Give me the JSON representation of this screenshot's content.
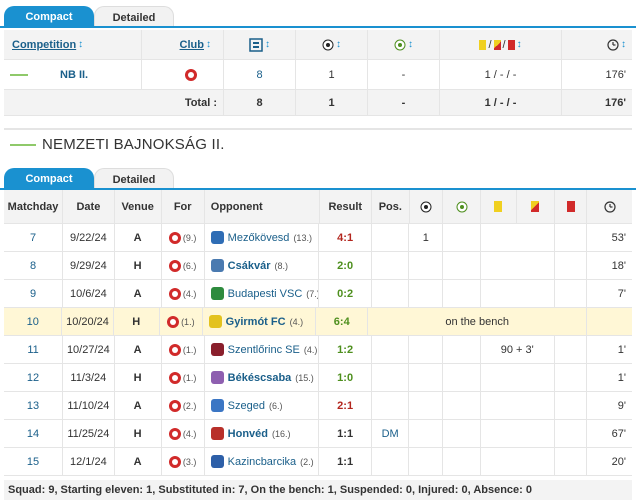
{
  "tabs_top": {
    "compact": "Compact",
    "detailed": "Detailed"
  },
  "summary": {
    "headers": {
      "competition": "Competition",
      "club": "Club"
    },
    "row": {
      "competition": "NB II.",
      "apps": "8",
      "goals": "1",
      "assists": "-",
      "cards": "1 / - / -",
      "minutes": "176'"
    },
    "total": {
      "label": "Total :",
      "apps": "8",
      "goals": "1",
      "assists": "-",
      "cards": "1 / - / -",
      "minutes": "176'"
    }
  },
  "section": {
    "title": "NEMZETI BAJNOKSÁG II."
  },
  "tabs_bottom": {
    "compact": "Compact",
    "detailed": "Detailed"
  },
  "matches_header": {
    "matchday": "Matchday",
    "date": "Date",
    "venue": "Venue",
    "for": "For",
    "opponent": "Opponent",
    "result": "Result",
    "pos": "Pos."
  },
  "matches": [
    {
      "matchday": "7",
      "date": "9/22/24",
      "venue": "A",
      "for_pos": "(9.)",
      "opponent": "Mezőkövesd",
      "opp_pos": "(13.)",
      "bold": false,
      "result": "4:1",
      "res_color": "red",
      "pos": "",
      "goals": "1",
      "assists": "",
      "sub": "",
      "yel": "",
      "yr": "",
      "red": "",
      "minutes": "53'",
      "crest_color": "#2f6db5"
    },
    {
      "matchday": "8",
      "date": "9/29/24",
      "venue": "H",
      "for_pos": "(6.)",
      "opponent": "Csákvár",
      "opp_pos": "(8.)",
      "bold": true,
      "result": "2:0",
      "res_color": "green",
      "pos": "",
      "goals": "",
      "assists": "",
      "sub": "",
      "yel": "",
      "yr": "",
      "red": "",
      "minutes": "18'",
      "crest_color": "#4a7ab0"
    },
    {
      "matchday": "9",
      "date": "10/6/24",
      "venue": "A",
      "for_pos": "(4.)",
      "opponent": "Budapesti VSC",
      "opp_pos": "(7.)",
      "bold": false,
      "result": "0:2",
      "res_color": "green",
      "pos": "",
      "goals": "",
      "assists": "",
      "sub": "",
      "yel": "",
      "yr": "",
      "red": "",
      "minutes": "7'",
      "crest_color": "#2e8b3e"
    },
    {
      "matchday": "10",
      "date": "10/20/24",
      "venue": "H",
      "for_pos": "(1.)",
      "opponent": "Gyirmót FC",
      "opp_pos": "(4.)",
      "bold": true,
      "result": "6:4",
      "res_color": "green",
      "bench": "on the bench",
      "crest_color": "#e3c21e"
    },
    {
      "matchday": "11",
      "date": "10/27/24",
      "venue": "A",
      "for_pos": "(1.)",
      "opponent": "Szentlőrinc SE",
      "opp_pos": "(4.)",
      "bold": false,
      "result": "1:2",
      "res_color": "green",
      "pos": "",
      "goals": "",
      "assists": "",
      "sub": "90 + 3'",
      "yel": "",
      "yr": "",
      "red": "",
      "minutes": "1'",
      "crest_color": "#8a1f2c"
    },
    {
      "matchday": "12",
      "date": "11/3/24",
      "venue": "H",
      "for_pos": "(1.)",
      "opponent": "Békéscsaba",
      "opp_pos": "(15.)",
      "bold": true,
      "result": "1:0",
      "res_color": "green",
      "pos": "",
      "goals": "",
      "assists": "",
      "sub": "",
      "yel": "",
      "yr": "",
      "red": "",
      "minutes": "1'",
      "crest_color": "#8e5fb0"
    },
    {
      "matchday": "13",
      "date": "11/10/24",
      "venue": "A",
      "for_pos": "(2.)",
      "opponent": "Szeged",
      "opp_pos": "(6.)",
      "bold": false,
      "result": "2:1",
      "res_color": "red",
      "pos": "",
      "goals": "",
      "assists": "",
      "sub": "",
      "yel": "",
      "yr": "",
      "red": "",
      "minutes": "9'",
      "crest_color": "#3b76c4"
    },
    {
      "matchday": "14",
      "date": "11/25/24",
      "venue": "H",
      "for_pos": "(4.)",
      "opponent": "Honvéd",
      "opp_pos": "(16.)",
      "bold": true,
      "result": "1:1",
      "res_color": "grey",
      "pos": "DM",
      "goals": "",
      "assists": "",
      "sub": "",
      "yel": "",
      "yr": "",
      "red": "",
      "minutes": "67'",
      "crest_color": "#b8302a"
    },
    {
      "matchday": "15",
      "date": "12/1/24",
      "venue": "A",
      "for_pos": "(3.)",
      "opponent": "Kazincbarcika",
      "opp_pos": "(2.)",
      "bold": false,
      "result": "1:1",
      "res_color": "grey",
      "pos": "",
      "goals": "",
      "assists": "",
      "sub": "",
      "yel": "",
      "yr": "",
      "red": "",
      "minutes": "20'",
      "crest_color": "#2d5fa8"
    }
  ],
  "footer": {
    "text": "Squad: 9, Starting eleven: 1, Substituted in: 7, On the bench: 1, Suspended: 0, Injured: 0, Absence: 0"
  },
  "colors": {
    "accent": "#1a91d0",
    "link": "#1a5f8a",
    "highlight": "#fff7d6",
    "win": "#4e8f1e",
    "loss": "#b3261e"
  }
}
